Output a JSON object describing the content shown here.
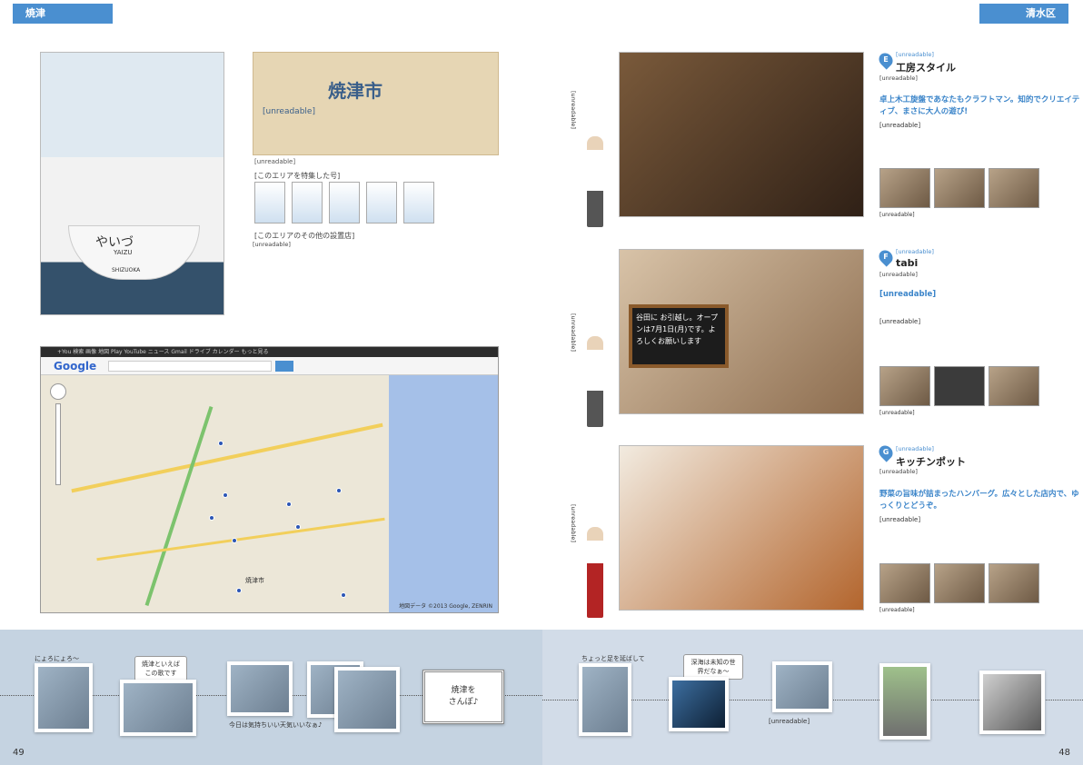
{
  "left_page": {
    "tab_label": "焼津",
    "page_number": "49",
    "title": "焼津市",
    "intro": "[unreadable]",
    "map_note": "[unreadable]",
    "issues_label": "[このエリアを特集した号]",
    "other_spots_label": "[このエリアのその他の設置店]",
    "other_spots_text": "[unreadable]",
    "photo_text": {
      "ship_name_kana": "やいづ",
      "ship_name_roman": "YAIZU",
      "ship_port": "SHIZUOKA"
    },
    "map": {
      "topbar": "+You  検索  画像  地図  Play  YouTube  ニュース  Gmail  ドライブ  カレンダー  もっと見る",
      "logo": "Google",
      "credit": "地図データ ©2013 Google, ZENRIN",
      "city_label": "焼津市"
    }
  },
  "right_page": {
    "tab_label": "清水区",
    "page_number": "48",
    "shops": [
      {
        "badge": "E",
        "sub": "[unreadable]",
        "name": "工房スタイル",
        "info": "[unreadable]",
        "lead": "卓上木工旋盤であなたもクラフトマン。知的でクリエイティブ、まさに大人の遊び!",
        "body": "[unreadable]",
        "side_caption": "[unreadable]",
        "mini_caption": "[unreadable]"
      },
      {
        "badge": "F",
        "sub": "[unreadable]",
        "name": "tabi",
        "info": "[unreadable]",
        "lead": "[unreadable]",
        "body": "[unreadable]",
        "side_caption": "[unreadable]",
        "mini_caption": "[unreadable]",
        "sign_text": "谷田に お引越し。オープンは7月1日(月)です。よろしくお願いします"
      },
      {
        "badge": "G",
        "sub": "[unreadable]",
        "name": "キッチンポット",
        "info": "[unreadable]",
        "lead": "野菜の旨味が詰まったハンバーグ。広々とした店内で、ゆっくりとどうぞ。",
        "body": "[unreadable]",
        "side_caption": "[unreadable]",
        "mini_caption": "[unreadable]"
      }
    ]
  },
  "bottom_strip": {
    "left_items": [
      {
        "caption": "にょろにょろ〜"
      },
      {
        "caption": "焼津といえばこの歌です"
      },
      {
        "caption": "今日は気持ちいい天気いいなぁ♪"
      },
      {
        "caption": ""
      }
    ],
    "stamp_line1": "焼津を",
    "stamp_line2": "さんぽ♪",
    "right_items": [
      {
        "caption": "ちょっと足を延ばして"
      },
      {
        "caption": "深海は未知の世界だなぁ〜"
      },
      {
        "caption": "[unreadable]"
      }
    ]
  }
}
